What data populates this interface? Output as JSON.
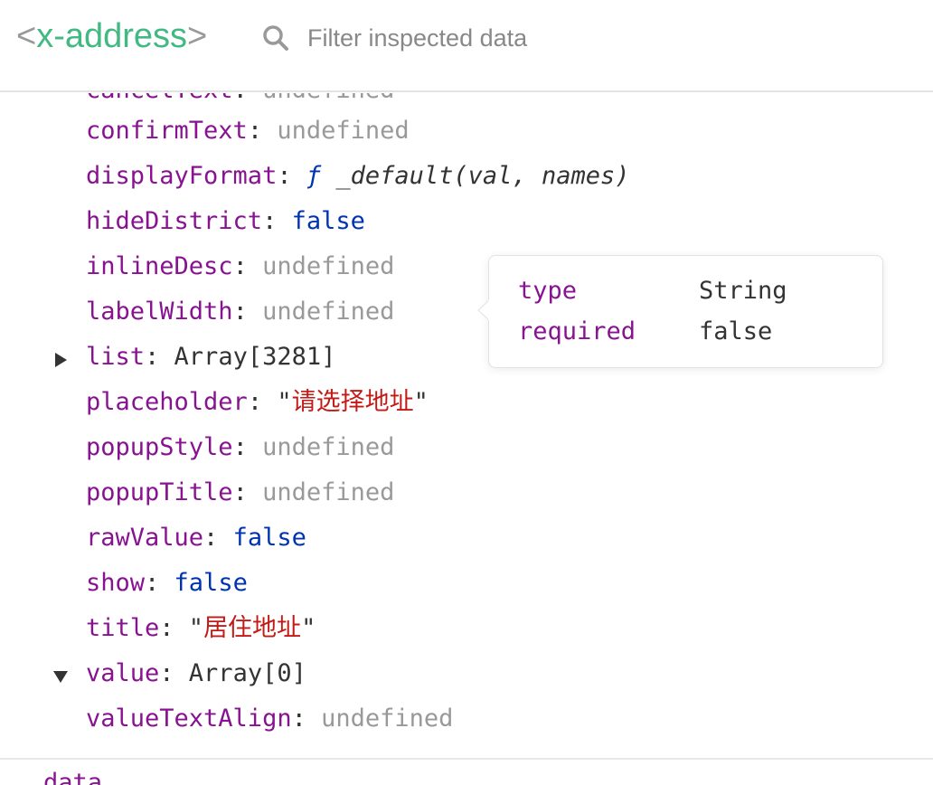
{
  "header": {
    "open_bracket": "<",
    "component_name": "x-address",
    "close_bracket": ">",
    "search_placeholder": "Filter inspected data"
  },
  "props": [
    {
      "key": "cancelText",
      "value": "undefined",
      "kind": "undefined"
    },
    {
      "key": "confirmText",
      "value": "undefined",
      "kind": "undefined"
    },
    {
      "key": "displayFormat",
      "fn_keyword": "ƒ",
      "value": "_default(val, names)",
      "kind": "function"
    },
    {
      "key": "hideDistrict",
      "value": "false",
      "kind": "literal"
    },
    {
      "key": "inlineDesc",
      "value": "undefined",
      "kind": "undefined"
    },
    {
      "key": "labelWidth",
      "value": "undefined",
      "kind": "undefined"
    },
    {
      "key": "list",
      "value": "Array[3281]",
      "kind": "plain",
      "expand": "collapsed"
    },
    {
      "key": "placeholder",
      "value": "请选择地址",
      "kind": "string"
    },
    {
      "key": "popupStyle",
      "value": "undefined",
      "kind": "undefined"
    },
    {
      "key": "popupTitle",
      "value": "undefined",
      "kind": "undefined"
    },
    {
      "key": "rawValue",
      "value": "false",
      "kind": "literal"
    },
    {
      "key": "show",
      "value": "false",
      "kind": "literal"
    },
    {
      "key": "title",
      "value": "居住地址",
      "kind": "string"
    },
    {
      "key": "value",
      "value": "Array[0]",
      "kind": "plain",
      "expand": "expanded"
    },
    {
      "key": "valueTextAlign",
      "value": "undefined",
      "kind": "undefined"
    }
  ],
  "tooltip": {
    "rows": [
      {
        "key": "type",
        "value": "String"
      },
      {
        "key": "required",
        "value": "false"
      }
    ]
  },
  "next_section": {
    "label": "data"
  },
  "colors": {
    "component_name": "#42b983",
    "key": "#881391",
    "undefined": "#999999",
    "literal": "#0033b3",
    "string": "#c41a16"
  }
}
